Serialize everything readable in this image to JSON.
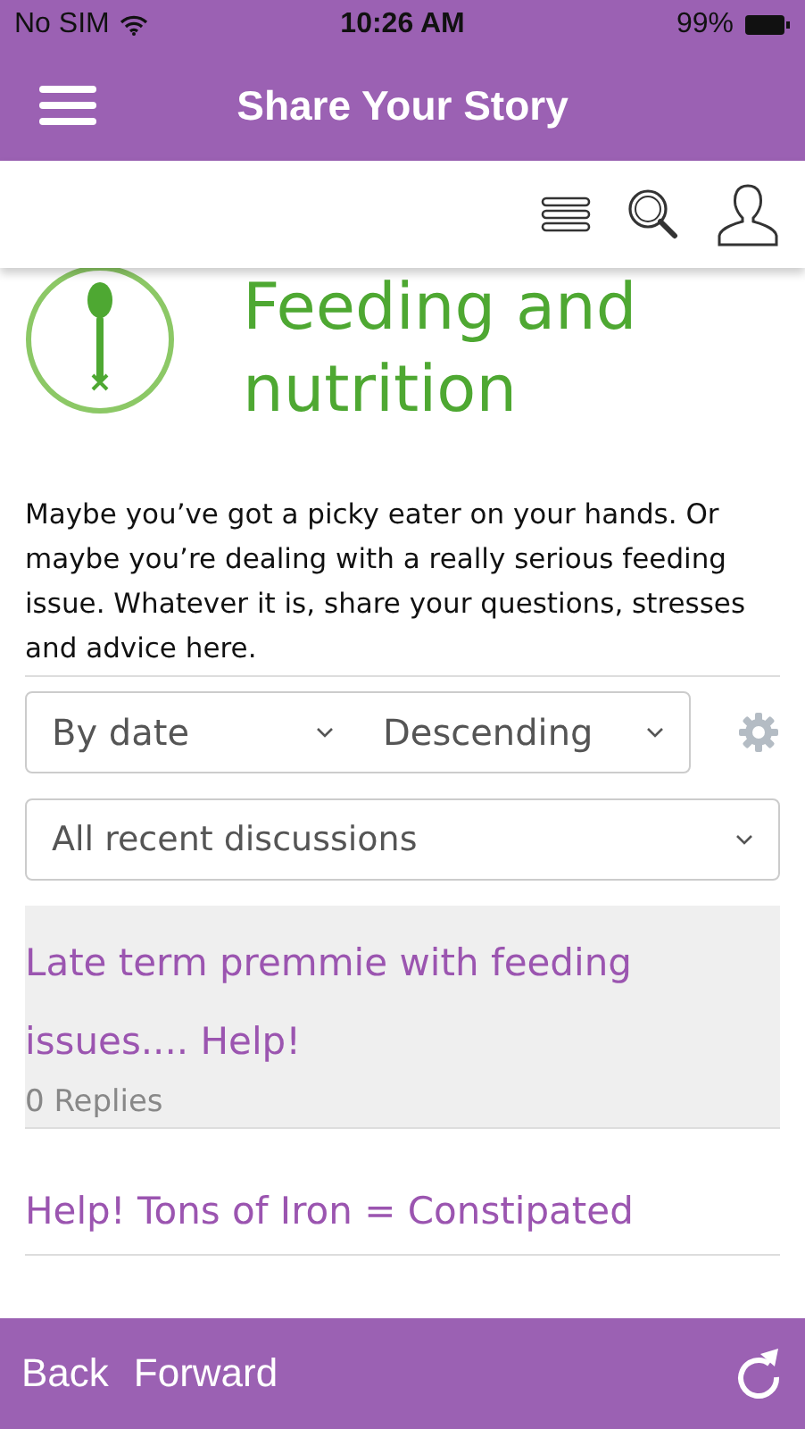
{
  "status_bar": {
    "carrier": "No SIM",
    "time": "10:26 AM",
    "battery": "99%"
  },
  "nav": {
    "title": "Share Your Story"
  },
  "category": {
    "title": "Feeding and nutrition",
    "description": "Maybe you’ve got a picky eater on your hands. Or maybe you’re dealing with a really serious feeding issue. Whatever it is, share your questions, stresses and advice here."
  },
  "sort": {
    "order_by": "By date",
    "direction": "Descending",
    "filter": "All recent discussions"
  },
  "posts": [
    {
      "title": "Late term premmie with feeding issues.... Help!",
      "replies": "0 Replies",
      "highlighted": true
    },
    {
      "title": "Help! Tons of Iron = Constipated",
      "highlighted": false
    }
  ],
  "bottom_bar": {
    "back": "Back",
    "forward": "Forward"
  }
}
